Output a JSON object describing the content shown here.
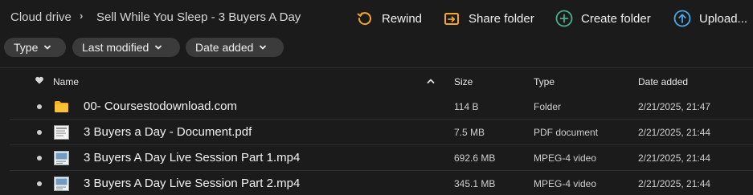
{
  "breadcrumb": {
    "root": "Cloud drive",
    "separator": "›",
    "current": "Sell While You Sleep - 3 Buyers A Day"
  },
  "actions": {
    "rewind": "Rewind",
    "share_folder": "Share folder",
    "create_folder": "Create folder",
    "upload": "Upload..."
  },
  "filters": {
    "type": "Type",
    "last_modified": "Last modified",
    "date_added": "Date added"
  },
  "table": {
    "columns": {
      "name": "Name",
      "size": "Size",
      "type": "Type",
      "date_added": "Date added"
    },
    "sort": {
      "column": "name",
      "direction": "ascending"
    },
    "rows": [
      {
        "name": "00- Coursestodownload.com",
        "size": "114 B",
        "type": "Folder",
        "date_added": "2/21/2025, 21:47",
        "icon": "folder-icon"
      },
      {
        "name": "3 Buyers a Day - Document.pdf",
        "size": "7.5 MB",
        "type": "PDF document",
        "date_added": "2/21/2025, 21:44",
        "icon": "document-thumbnail-icon"
      },
      {
        "name": "3 Buyers A Day Live Session Part 1.mp4",
        "size": "692.6 MB",
        "type": "MPEG-4 video",
        "date_added": "2/21/2025, 21:44",
        "icon": "video-thumbnail-icon"
      },
      {
        "name": "3 Buyers A Day Live Session Part 2.mp4",
        "size": "345.1 MB",
        "type": "MPEG-4 video",
        "date_added": "2/21/2025, 21:44",
        "icon": "video-thumbnail-icon"
      }
    ]
  },
  "colors": {
    "background": "#1b1b1b",
    "chip": "#3b3b3b",
    "rewind": "#f5a623",
    "share": "#f5a623",
    "create": "#4caf8a",
    "upload": "#4aa8e8",
    "folder": "#f5b21b"
  }
}
